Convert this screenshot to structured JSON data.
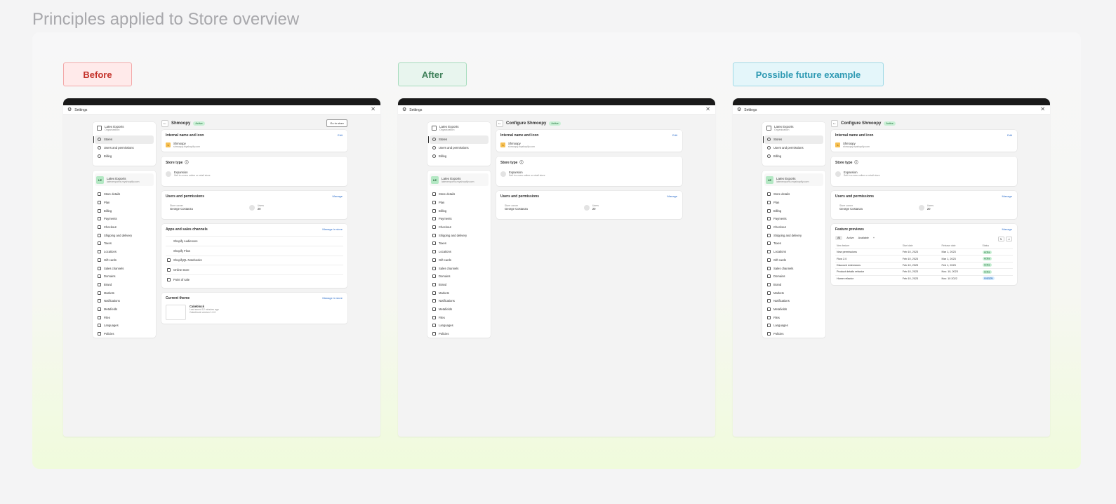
{
  "page_title": "Principles applied to Store overview",
  "labels": {
    "before": "Before",
    "after": "After",
    "future": "Possible future example"
  },
  "settings_title": "Settings",
  "org": {
    "name": "Latex Exports",
    "type": "Organization"
  },
  "org_nav": [
    "Stores",
    "Users and permissions",
    "Billing"
  ],
  "store": {
    "initials": "LE",
    "name": "Latex Exports",
    "domain": "latexexports.myshopify.com"
  },
  "store_nav": [
    "Store details",
    "Plan",
    "Billing",
    "Payments",
    "Checkout",
    "Shipping and delivery",
    "Taxes",
    "Locations",
    "Gift cards",
    "Sales channels",
    "Domains",
    "Brand",
    "Markets",
    "Notifications",
    "Metafields",
    "Files",
    "Languages",
    "Policies"
  ],
  "before": {
    "title": "Shmoopy",
    "badge": "Active",
    "go_button": "Go to store",
    "sections": {
      "internal": "Internal name and icon",
      "edit": "Edit",
      "store_name": "Shmoopy",
      "store_domain": "shmoopy.myshopify.com",
      "store_type": "Store type",
      "type_name": "Expansion",
      "type_desc": "Sell in a new online or retail store",
      "users": "Users and permissions",
      "manage": "Manage",
      "owner_label": "Store owner",
      "owner": "George Costanza",
      "users_label": "Users",
      "users_count": "20",
      "apps": "Apps and sales channels",
      "manage_store": "Manage in store",
      "app_list": [
        "Shopify Audiences",
        "Shopify Flow",
        "ShopifyQL Notebooks",
        "Online store",
        "Point of sale"
      ],
      "theme": "Current theme",
      "theme_manage": "Manage in store",
      "theme_name": "Cakeblock",
      "theme_saved": "Last saved 12 minutes ago",
      "theme_version": "Cakeblock version 1.0.0"
    }
  },
  "after": {
    "title": "Configure Shmoopy",
    "badge": "Active",
    "store_domain": "shmoopy.myshopify.com",
    "type_desc": "Sell in a new online or retail store"
  },
  "future": {
    "title": "Configure Shmoopy",
    "badge": "Active",
    "store_domain": "shmoopy.myshopify.com",
    "type_desc": "Sell in a new online or retail store",
    "previews": "Feature previews",
    "manage": "Manage",
    "filters": [
      "All",
      "Active",
      "Available"
    ],
    "columns": [
      "New feature",
      "Start date",
      "Release date",
      "Status"
    ],
    "rows": [
      [
        "New permissions",
        "Feb 10, 2023",
        "Mar 1, 2023",
        "Active"
      ],
      [
        "Flow 2.0",
        "Feb 10, 2023",
        "Mar 1, 2023",
        "Active"
      ],
      [
        "Discount extensions",
        "Feb 10, 2023",
        "Feb 1, 2023",
        "Active"
      ],
      [
        "Product details refactor",
        "Feb 10, 2023",
        "Nov. 10, 2023",
        "Active"
      ],
      [
        "Home refactor",
        "Feb 10, 2023",
        "Nov. 10 2022",
        "Available"
      ]
    ]
  }
}
